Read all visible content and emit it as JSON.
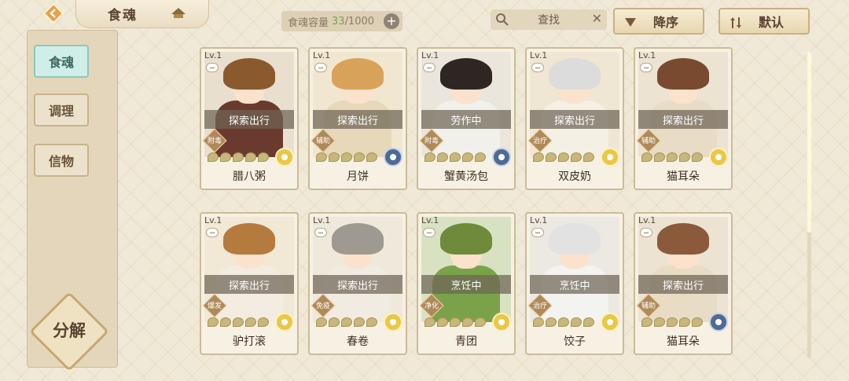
{
  "header": {
    "title": "食魂",
    "capacity_label": "食魂容量",
    "capacity_current": "33",
    "capacity_max": "/1000",
    "search_placeholder": "查找",
    "sort_order_label": "降序",
    "sort_mode_label": "默认"
  },
  "sidebar": {
    "items": [
      {
        "label": "食魂",
        "active": true
      },
      {
        "label": "调理",
        "active": false
      },
      {
        "label": "信物",
        "active": false
      }
    ],
    "decompose_label": "分解"
  },
  "cards": [
    {
      "level": "Lv.1",
      "status": "探索出行",
      "role": "附毒",
      "name": "腊八粥",
      "stars": 0,
      "element": "gold",
      "hair": "#8a5a2e",
      "clothes": "#6b3a2e",
      "bg": "#e9dfcf"
    },
    {
      "level": "Lv.1",
      "status": "探索出行",
      "role": "辅助",
      "name": "月饼",
      "stars": 0,
      "element": "blue",
      "hair": "#d8a25a",
      "clothes": "#e6d8b8",
      "bg": "#f1e6cf"
    },
    {
      "level": "Lv.1",
      "status": "劳作中",
      "role": "附毒",
      "name": "蟹黄汤包",
      "stars": 0,
      "element": "blue",
      "hair": "#2e2622",
      "clothes": "#f2f0ea",
      "bg": "#eae6dc"
    },
    {
      "level": "Lv.1",
      "status": "探索出行",
      "role": "治疗",
      "name": "双皮奶",
      "stars": 0,
      "element": "gold",
      "hair": "#dcdcdc",
      "clothes": "#f4f0e4",
      "bg": "#efe6d4"
    },
    {
      "level": "Lv.1",
      "status": "探索出行",
      "role": "辅助",
      "name": "猫耳朵",
      "stars": 0,
      "element": "gold",
      "hair": "#7a4a30",
      "clothes": "#e8dcc6",
      "bg": "#ece3d2"
    },
    {
      "level": "Lv.1",
      "status": "探索出行",
      "role": "爆发",
      "name": "驴打滚",
      "stars": 0,
      "element": "gold",
      "hair": "#b47a3e",
      "clothes": "#f3ece0",
      "bg": "#f1e8d6"
    },
    {
      "level": "Lv.1",
      "status": "探索出行",
      "role": "免疫",
      "name": "春卷",
      "stars": 0,
      "element": "gold",
      "hair": "#9e9a92",
      "clothes": "#f0ece2",
      "bg": "#efe9dc"
    },
    {
      "level": "Lv.1",
      "status": "烹饪中",
      "role": "净化",
      "name": "青团",
      "stars": 0,
      "element": "gold",
      "hair": "#6f8a3a",
      "clothes": "#7aa24a",
      "bg": "#d8e2c2"
    },
    {
      "level": "Lv.1",
      "status": "烹饪中",
      "role": "治疗",
      "name": "饺子",
      "stars": 0,
      "element": "gold",
      "hair": "#e2e2e2",
      "clothes": "#f3f3f0",
      "bg": "#ece9e2"
    },
    {
      "level": "Lv.1",
      "status": "探索出行",
      "role": "辅助",
      "name": "猫耳朵",
      "stars": 0,
      "element": "blue",
      "hair": "#8a5a3a",
      "clothes": "#e8dcc6",
      "bg": "#ece3d2"
    }
  ]
}
